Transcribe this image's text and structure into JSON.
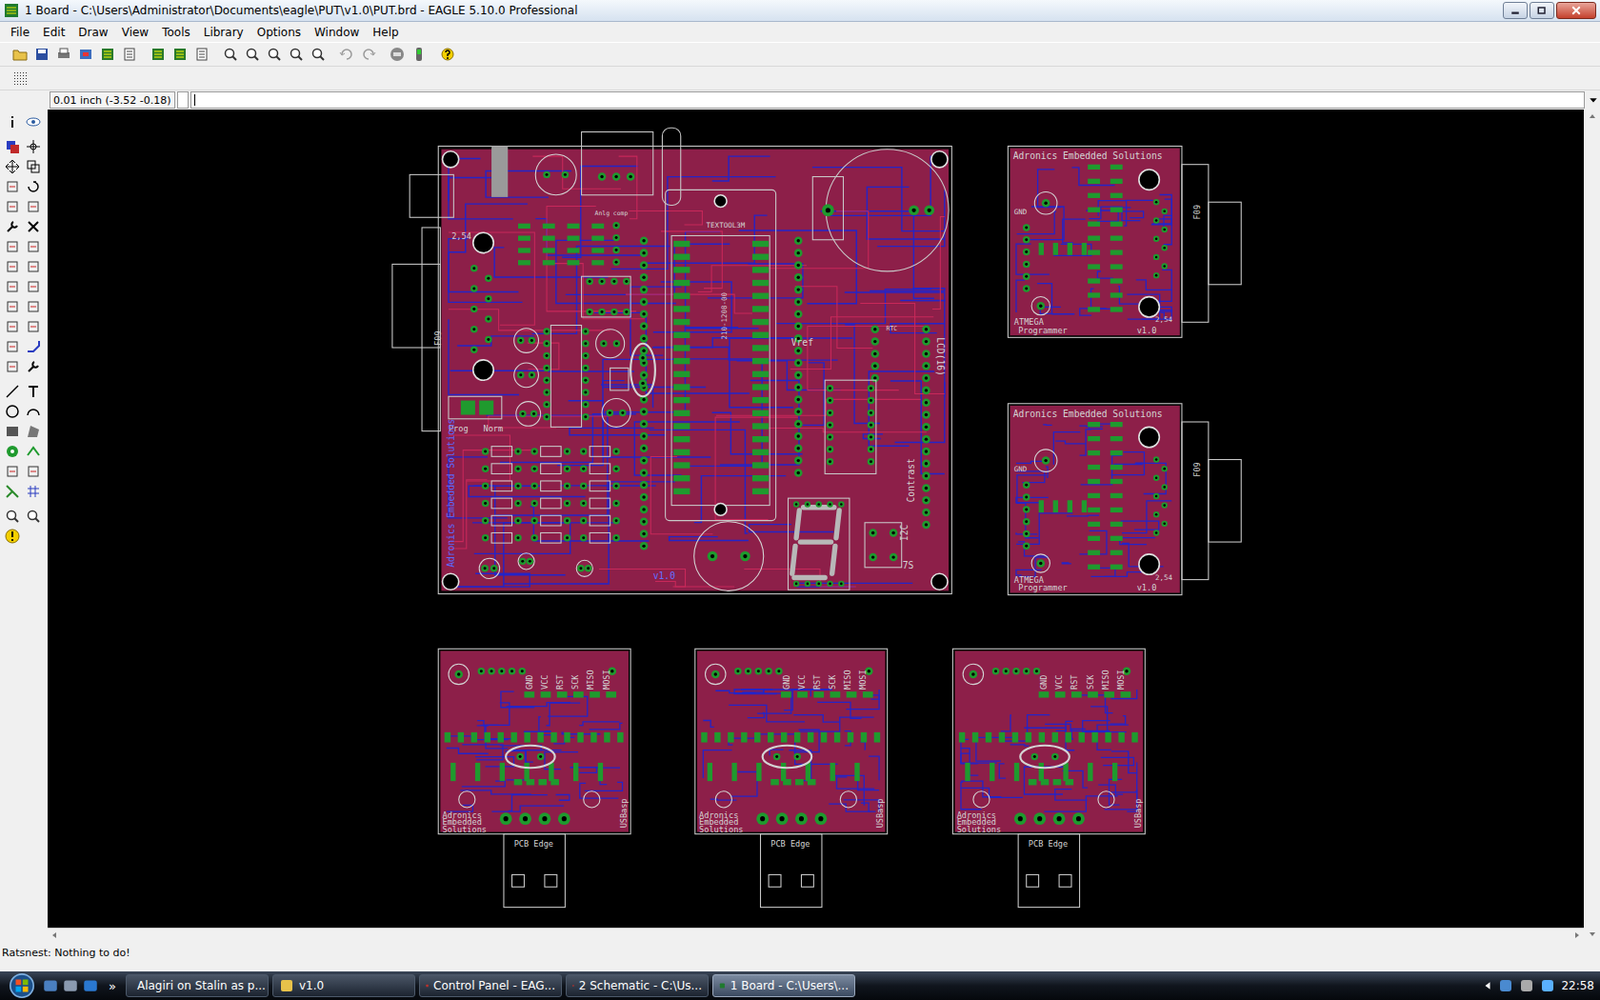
{
  "window": {
    "title": "1 Board - C:\\Users\\Administrator\\Documents\\eagle\\PUT\\v1.0\\PUT.brd - EAGLE 5.10.0 Professional"
  },
  "menu": [
    "File",
    "Edit",
    "Draw",
    "View",
    "Tools",
    "Library",
    "Options",
    "Window",
    "Help"
  ],
  "command": {
    "coords": "0.01 inch (-3.52 -0.18)"
  },
  "main_board": {
    "labels": [
      "TEXTOOL3M",
      "2,54",
      "F09",
      "Prog",
      "Norm",
      "Anlg comp",
      "210-1208-00",
      "Vref",
      "RTC",
      "Contrast",
      "LCD(16)",
      "I2C",
      "7S",
      "Adronics Embedded Solutions",
      "v1.0"
    ]
  },
  "programmers": [
    {
      "company": "Adronics Embedded Solutions",
      "title_line1": "ATMEGA",
      "title_line2": "Programmer",
      "version": "v1.0",
      "connector": "F09",
      "pitch": "2,54",
      "pin": "GND"
    },
    {
      "company": "Adronics Embedded Solutions",
      "title_line1": "ATMEGA",
      "title_line2": "Programmer",
      "version": "v1.0",
      "connector": "F09",
      "pitch": "2,54",
      "pin": "GND"
    }
  ],
  "usbasp": [
    {
      "company_lines": [
        "Adronics",
        "Embedded",
        "Solutions"
      ],
      "name": "USBasp",
      "edge": "PCB Edge",
      "pins": [
        "GND",
        "VCC",
        "RST",
        "SCK",
        "MISO",
        "MOSI"
      ]
    },
    {
      "company_lines": [
        "Adronics",
        "Embedded",
        "Solutions"
      ],
      "name": "USBasp",
      "edge": "PCB Edge",
      "pins": [
        "GND",
        "VCC",
        "RST",
        "SCK",
        "MISO",
        "MOSI"
      ]
    },
    {
      "company_lines": [
        "Adronics",
        "Embedded",
        "Solutions"
      ],
      "name": "USBasp",
      "edge": "PCB Edge",
      "pins": [
        "GND",
        "VCC",
        "RST",
        "SCK",
        "MISO",
        "MOSI"
      ]
    }
  ],
  "status_bar": {
    "text": "Ratsnest: Nothing to do!"
  },
  "taskbar": {
    "more": "»",
    "items": [
      {
        "label": "Alagiri on Stalin as p...",
        "selected": false
      },
      {
        "label": "v1.0",
        "selected": false
      },
      {
        "label": "Control Panel - EAG...",
        "selected": false
      },
      {
        "label": "2 Schematic - C:\\Us...",
        "selected": false
      },
      {
        "label": "1 Board - C:\\Users\\...",
        "selected": true
      }
    ],
    "clock": "22:58"
  }
}
